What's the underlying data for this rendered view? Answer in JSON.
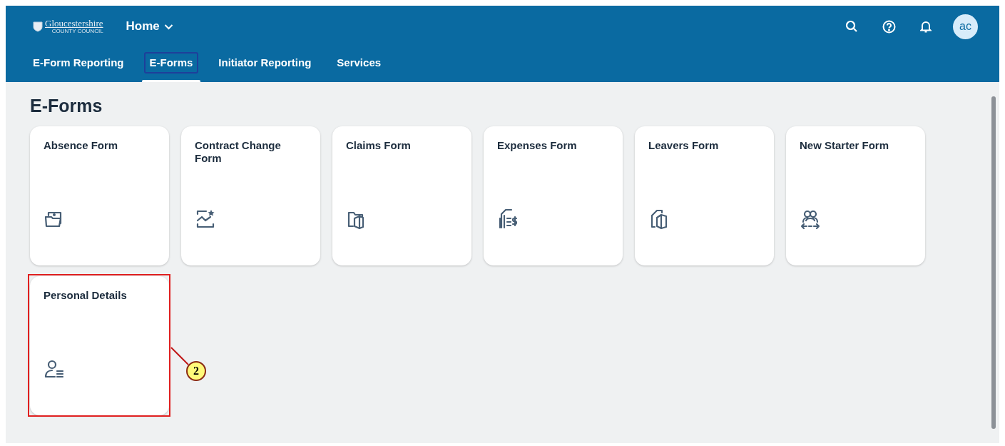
{
  "header": {
    "logo": {
      "name": "Gloucestershire",
      "subtitle": "COUNTY COUNCIL"
    },
    "menu_title": "Home",
    "avatar": "ac"
  },
  "tabs": [
    {
      "label": "E-Form Reporting",
      "selected": false
    },
    {
      "label": "E-Forms",
      "selected": true
    },
    {
      "label": "Initiator Reporting",
      "selected": false
    },
    {
      "label": "Services",
      "selected": false
    }
  ],
  "page_title": "E-Forms",
  "tiles": [
    {
      "title": "Absence Form",
      "kind": "photo",
      "highlighted": false
    },
    {
      "title": "Contract Change Form",
      "kind": "chart",
      "highlighted": false
    },
    {
      "title": "Claims Form",
      "kind": "folder",
      "highlighted": false
    },
    {
      "title": "Expenses Form",
      "kind": "money",
      "highlighted": false
    },
    {
      "title": "Leavers Form",
      "kind": "copy",
      "highlighted": false
    },
    {
      "title": "New Starter Form",
      "kind": "people",
      "highlighted": false
    },
    {
      "title": "Personal Details",
      "kind": "person",
      "highlighted": true
    }
  ],
  "callout": {
    "label": "2"
  }
}
